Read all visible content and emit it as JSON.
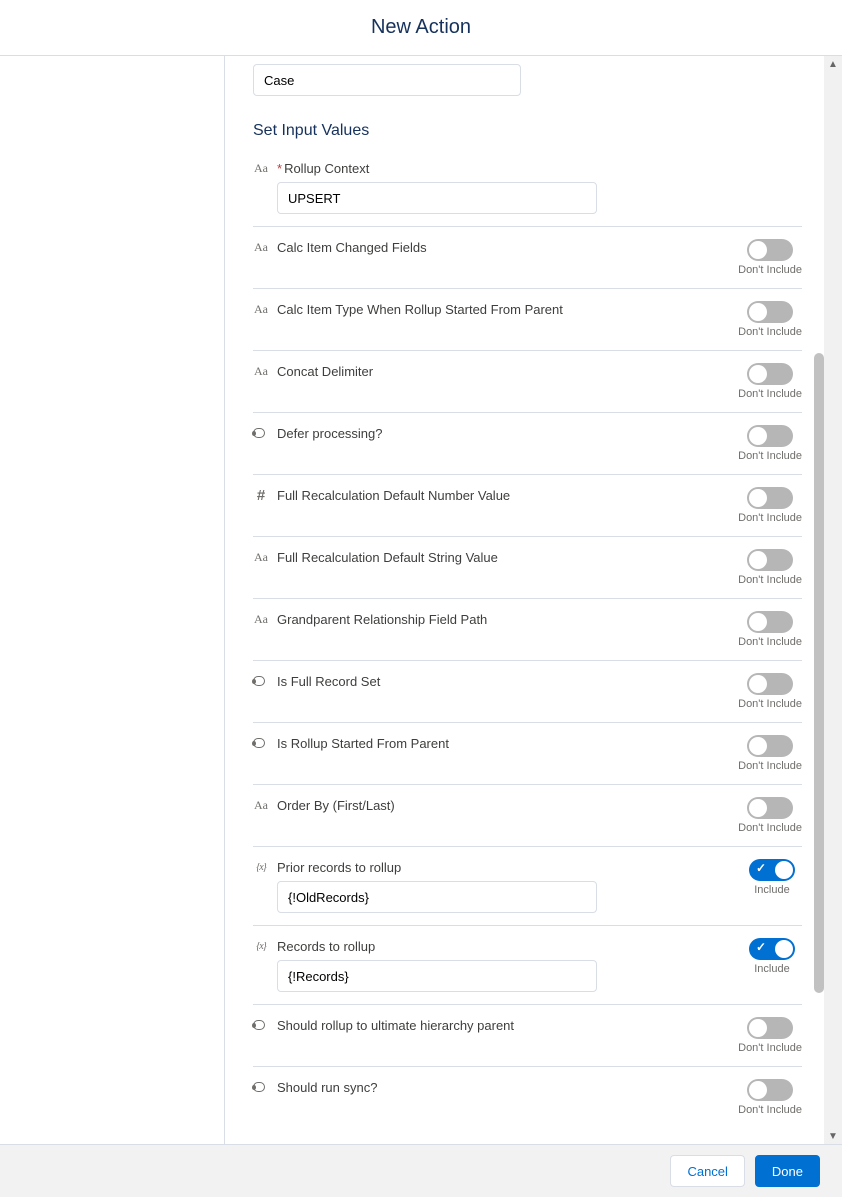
{
  "header": {
    "title": "New Action"
  },
  "topField": {
    "value": "Case"
  },
  "sectionTitle": "Set Input Values",
  "toggleLabels": {
    "on": "Include",
    "off": "Don't Include"
  },
  "rows": [
    {
      "icon": "Aa",
      "required": true,
      "label": "Rollup Context",
      "inputValue": "UPSERT",
      "toggle": null
    },
    {
      "icon": "Aa",
      "required": false,
      "label": "Calc Item Changed Fields",
      "inputValue": null,
      "toggle": false
    },
    {
      "icon": "Aa",
      "required": false,
      "label": "Calc Item Type When Rollup Started From Parent",
      "inputValue": null,
      "toggle": false
    },
    {
      "icon": "Aa",
      "required": false,
      "label": "Concat Delimiter",
      "inputValue": null,
      "toggle": false
    },
    {
      "icon": "bool",
      "required": false,
      "label": "Defer processing?",
      "inputValue": null,
      "toggle": false
    },
    {
      "icon": "hash",
      "required": false,
      "label": "Full Recalculation Default Number Value",
      "inputValue": null,
      "toggle": false
    },
    {
      "icon": "Aa",
      "required": false,
      "label": "Full Recalculation Default String Value",
      "inputValue": null,
      "toggle": false
    },
    {
      "icon": "Aa",
      "required": false,
      "label": "Grandparent Relationship Field Path",
      "inputValue": null,
      "toggle": false
    },
    {
      "icon": "bool",
      "required": false,
      "label": "Is Full Record Set",
      "inputValue": null,
      "toggle": false
    },
    {
      "icon": "bool",
      "required": false,
      "label": "Is Rollup Started From Parent",
      "inputValue": null,
      "toggle": false
    },
    {
      "icon": "Aa",
      "required": false,
      "label": "Order By (First/Last)",
      "inputValue": null,
      "toggle": false
    },
    {
      "icon": "var",
      "required": false,
      "label": "Prior records to rollup",
      "inputValue": "{!OldRecords}",
      "toggle": true
    },
    {
      "icon": "var",
      "required": false,
      "label": "Records to rollup",
      "inputValue": "{!Records}",
      "toggle": true
    },
    {
      "icon": "bool",
      "required": false,
      "label": "Should rollup to ultimate hierarchy parent",
      "inputValue": null,
      "toggle": false
    },
    {
      "icon": "bool",
      "required": false,
      "label": "Should run sync?",
      "inputValue": null,
      "toggle": false
    }
  ],
  "footer": {
    "cancel": "Cancel",
    "done": "Done"
  }
}
